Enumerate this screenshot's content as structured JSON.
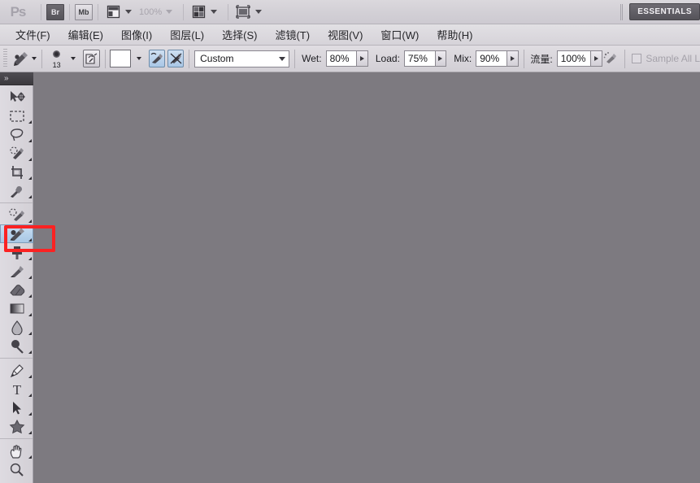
{
  "app": {
    "logo": "Ps",
    "title": "Adobe Photoshop"
  },
  "appbar": {
    "bridge_label": "Br",
    "mini_bridge_label": "Mb",
    "view_extras_icon": "view-extras-icon",
    "zoom_level": "100%",
    "arrange_documents_icon": "arrange-documents-icon",
    "screen_mode_icon": "screen-mode-icon",
    "workspace_label": "ESSENTIALS"
  },
  "menubar": {
    "items": [
      {
        "label": "文件(F)",
        "name": "menu-file"
      },
      {
        "label": "编辑(E)",
        "name": "menu-edit"
      },
      {
        "label": "图像(I)",
        "name": "menu-image"
      },
      {
        "label": "图层(L)",
        "name": "menu-layer"
      },
      {
        "label": "选择(S)",
        "name": "menu-select"
      },
      {
        "label": "滤镜(T)",
        "name": "menu-filter"
      },
      {
        "label": "视图(V)",
        "name": "menu-view"
      },
      {
        "label": "窗口(W)",
        "name": "menu-window"
      },
      {
        "label": "帮助(H)",
        "name": "menu-help"
      }
    ]
  },
  "options": {
    "active_tool": "mixer-brush-tool",
    "brush_size": "13",
    "brush_load_icon": "brush-load-well-icon",
    "color_swatch": "#ffffff",
    "load_after_stroke_icon": "load-brush-after-stroke-icon",
    "clean_after_stroke_icon": "clean-brush-after-stroke-icon",
    "preset_value": "Custom",
    "wet_label": "Wet:",
    "wet_value": "80%",
    "load_label": "Load:",
    "load_value": "75%",
    "mix_label": "Mix:",
    "mix_value": "90%",
    "flow_label": "流量:",
    "flow_value": "100%",
    "airbrush_icon": "airbrush-icon",
    "sample_all_layers_label": "Sample All L",
    "sample_all_layers_checked": false
  },
  "toolbar": {
    "collapse_label": "»",
    "groups": [
      {
        "tools": [
          {
            "name": "move-tool",
            "label": "移动工具",
            "has_flyout": false
          },
          {
            "name": "rectangular-marquee-tool",
            "label": "矩形选框工具",
            "has_flyout": true
          },
          {
            "name": "lasso-tool",
            "label": "套索工具",
            "has_flyout": true
          },
          {
            "name": "quick-selection-tool",
            "label": "快速选择工具",
            "has_flyout": true
          },
          {
            "name": "crop-tool",
            "label": "裁剪工具",
            "has_flyout": true
          },
          {
            "name": "eyedropper-tool",
            "label": "吸管工具",
            "has_flyout": true
          }
        ]
      },
      {
        "tools": [
          {
            "name": "spot-healing-brush-tool",
            "label": "污点修复画笔工具",
            "has_flyout": true
          },
          {
            "name": "mixer-brush-tool",
            "label": "混合器画笔工具",
            "has_flyout": true,
            "selected": true
          },
          {
            "name": "clone-stamp-tool",
            "label": "仿制图章工具",
            "has_flyout": true
          },
          {
            "name": "history-brush-tool",
            "label": "历史记录画笔工具",
            "has_flyout": true
          },
          {
            "name": "eraser-tool",
            "label": "橡皮擦工具",
            "has_flyout": true
          },
          {
            "name": "gradient-tool",
            "label": "渐变工具",
            "has_flyout": true
          },
          {
            "name": "blur-tool",
            "label": "模糊工具",
            "has_flyout": true
          },
          {
            "name": "dodge-tool",
            "label": "减淡工具",
            "has_flyout": true
          }
        ]
      },
      {
        "tools": [
          {
            "name": "pen-tool",
            "label": "钢笔工具",
            "has_flyout": true
          },
          {
            "name": "horizontal-type-tool",
            "label": "横排文字工具",
            "has_flyout": true
          },
          {
            "name": "path-selection-tool",
            "label": "路径选择工具",
            "has_flyout": true
          },
          {
            "name": "custom-shape-tool",
            "label": "自定形状工具",
            "has_flyout": true
          }
        ]
      },
      {
        "tools": [
          {
            "name": "hand-tool",
            "label": "抓手工具",
            "has_flyout": true
          },
          {
            "name": "zoom-tool",
            "label": "缩放工具",
            "has_flyout": false
          }
        ]
      }
    ]
  },
  "canvas": {
    "background_color": "#7d7a80"
  },
  "annotation": {
    "color": "#fb2222",
    "target": "mixer-brush-tool"
  }
}
